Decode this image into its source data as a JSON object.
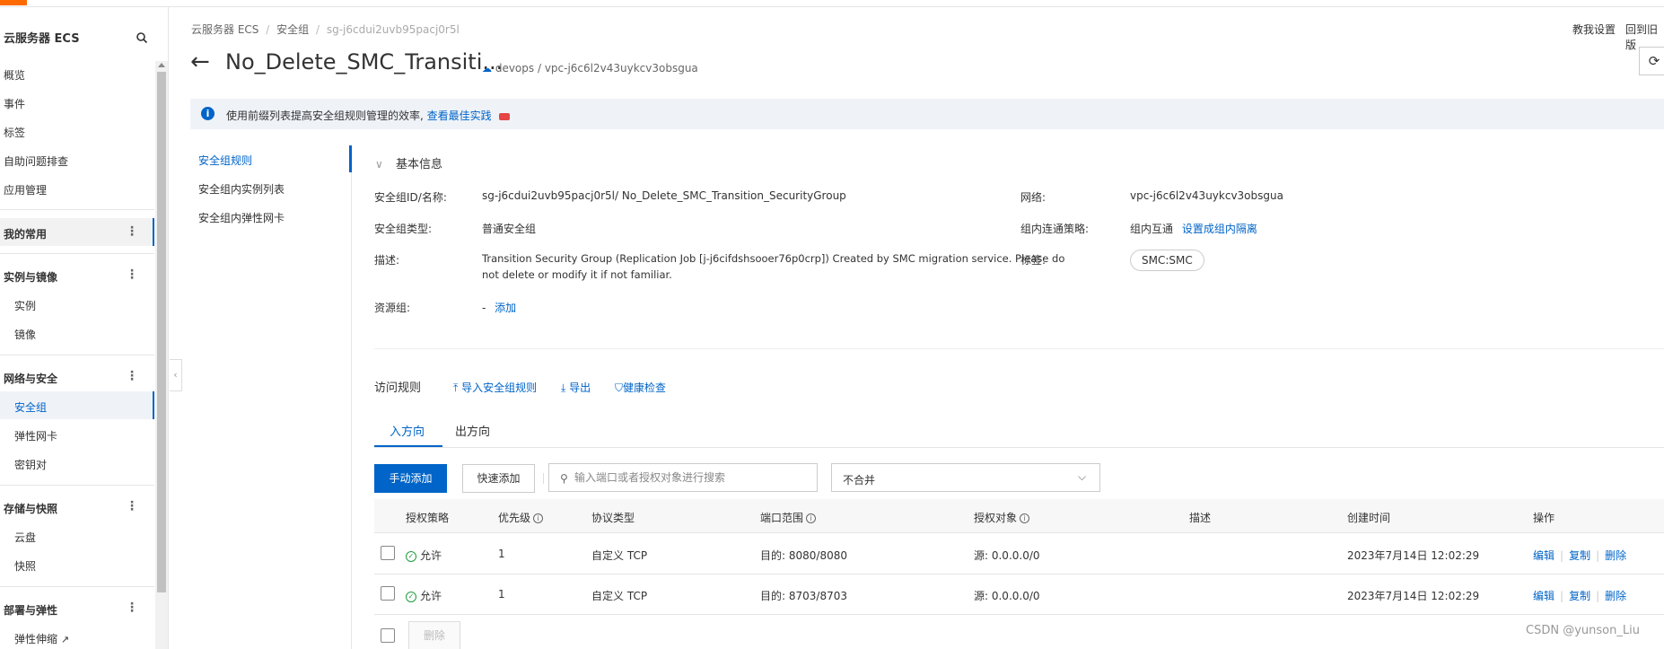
{
  "sidebar": {
    "title": "云服务器 ECS",
    "top_items": [
      "概览",
      "事件",
      "标签",
      "自助问题排查",
      "应用管理"
    ],
    "favorites": "我的常用",
    "groups": [
      {
        "label": "实例与镜像",
        "items": [
          "实例",
          "镜像"
        ]
      },
      {
        "label": "网络与安全",
        "items": [
          "安全组",
          "弹性网卡",
          "密钥对"
        ]
      },
      {
        "label": "存储与快照",
        "items": [
          "云盘",
          "快照"
        ]
      },
      {
        "label": "部署与弹性",
        "items": [
          "弹性伸缩"
        ]
      }
    ]
  },
  "breadcrumb": {
    "c1": "云服务器 ECS",
    "c2": "安全组",
    "c3": "sg-j6cdui2uvb95pacj0r5l",
    "sep": "/"
  },
  "topright": {
    "help": "教我设置",
    "old": "回到旧版"
  },
  "header": {
    "title": "No_Delete_SMC_Transiti...",
    "meta": "devops / vpc-j6c6l2v43uykcv3obsgua"
  },
  "notice": {
    "text": "使用前缀列表提高安全组规则管理的效率,",
    "link": "查看最佳实践"
  },
  "inner_nav": [
    "安全组规则",
    "安全组内实例列表",
    "安全组内弹性网卡"
  ],
  "basic_info": {
    "title": "基本信息",
    "id_label": "安全组ID/名称:",
    "id_value": "sg-j6cdui2uvb95pacj0r5l/ No_Delete_SMC_Transition_SecurityGroup",
    "network_label": "网络:",
    "network_value": "vpc-j6c6l2v43uykcv3obsgua",
    "type_label": "安全组类型:",
    "type_value": "普通安全组",
    "policy_label": "组内连通策略:",
    "policy_value": "组内互通",
    "policy_link": "设置成组内隔离",
    "desc_label": "描述:",
    "desc_line1": "Transition Security Group (Replication Job [j-j6cifdshsooer76p0crp]) Created by SMC migration service. Please do",
    "desc_line2": "not delete or modify it if not familiar.",
    "tag_label": "标签:",
    "tag_value": "SMC:SMC",
    "rg_label": "资源组:",
    "rg_value": "-",
    "rg_link": "添加"
  },
  "access_rules": {
    "title": "访问规则",
    "import": "导入安全组规则",
    "export": "导出",
    "health": "健康检查",
    "tabs": [
      "入方向",
      "出方向"
    ],
    "btn_manual": "手动添加",
    "btn_quick": "快速添加",
    "search_placeholder": "输入端口或者授权对象进行搜索",
    "select_value": "不合并",
    "columns": [
      "授权策略",
      "优先级",
      "协议类型",
      "端口范围",
      "授权对象",
      "描述",
      "创建时间",
      "操作"
    ],
    "rows": [
      {
        "policy": "允许",
        "priority": "1",
        "protocol": "自定义 TCP",
        "port": "目的: 8080/8080",
        "source": "源: 0.0.0.0/0",
        "desc": "",
        "created": "2023年7月14日 12:02:29",
        "a1": "编辑",
        "a2": "复制",
        "a3": "删除"
      },
      {
        "policy": "允许",
        "priority": "1",
        "protocol": "自定义 TCP",
        "port": "目的: 8703/8703",
        "source": "源: 0.0.0.0/0",
        "desc": "",
        "created": "2023年7月14日 12:02:29",
        "a1": "编辑",
        "a2": "复制",
        "a3": "删除"
      }
    ],
    "btn_delete": "删除"
  },
  "watermark": "CSDN @yunson_Liu",
  "colors": {
    "accent": "#0064c8",
    "success": "#1e9e3e",
    "brand": "#ff6a00"
  }
}
